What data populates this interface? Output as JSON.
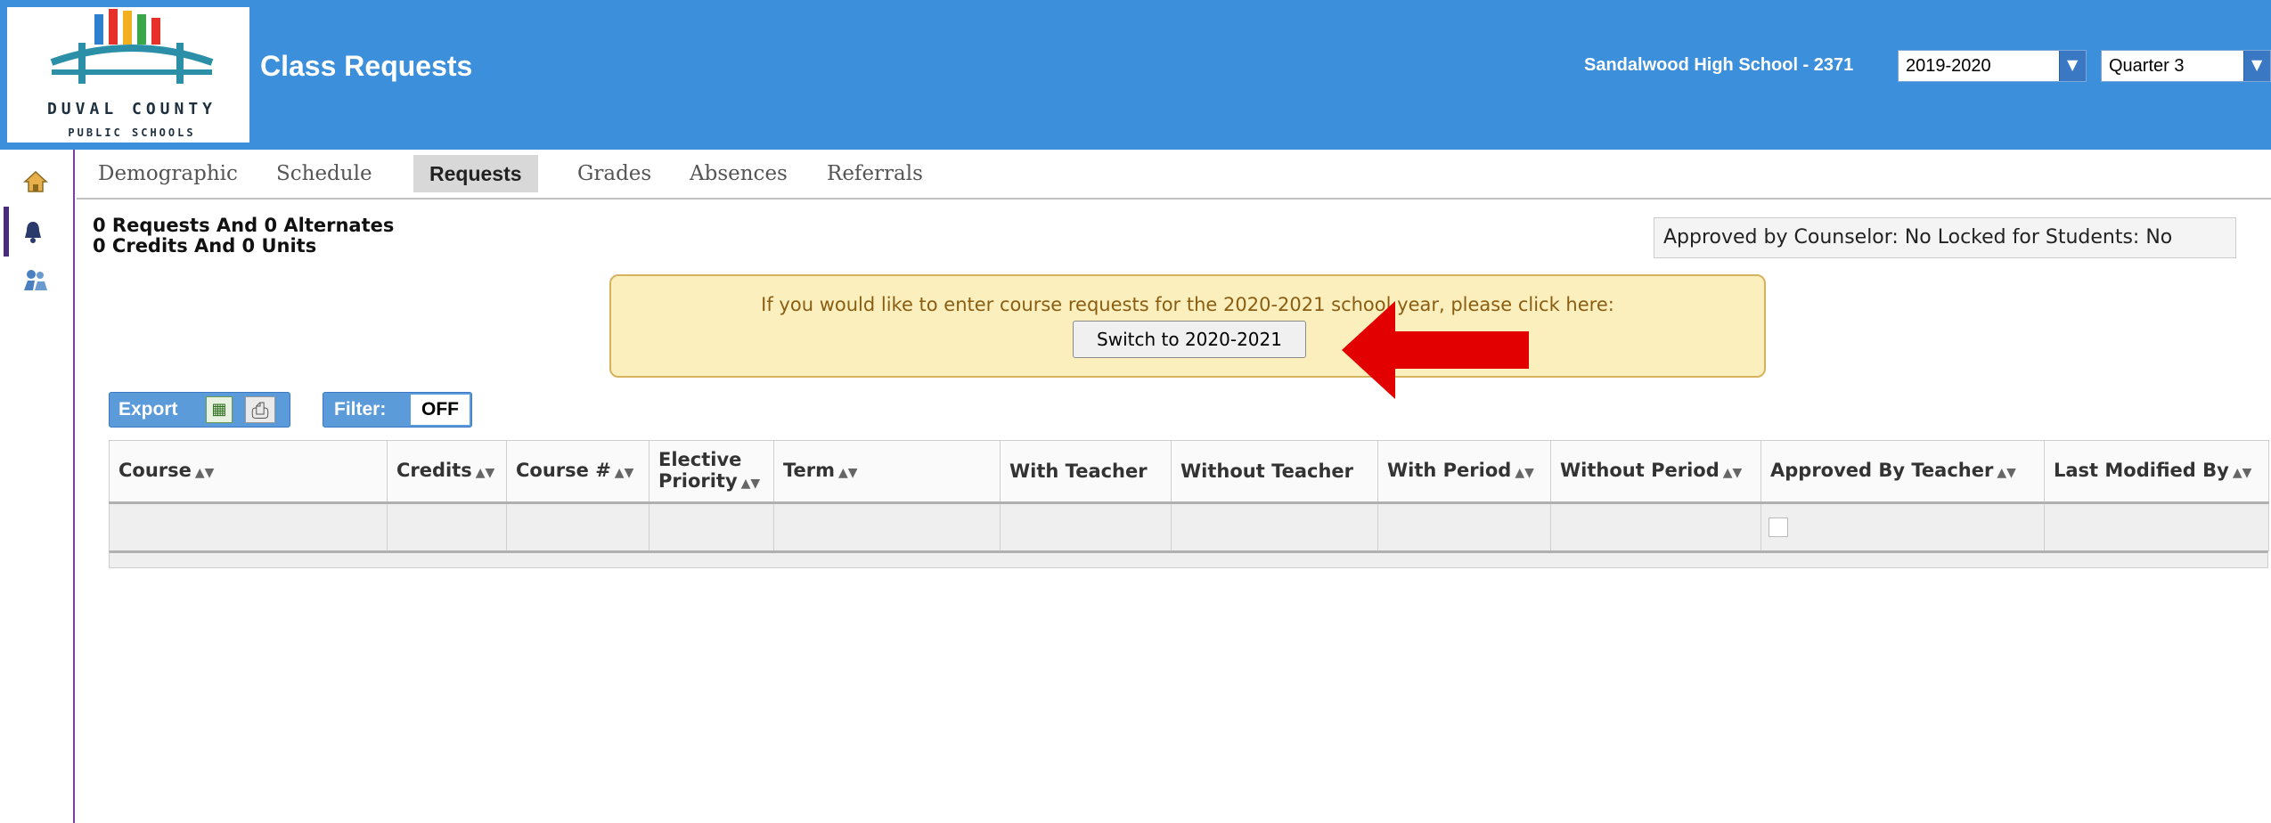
{
  "header": {
    "logo_line1": "DUVAL COUNTY",
    "logo_line2": "PUBLIC SCHOOLS",
    "title": "Class Requests",
    "school": "Sandalwood High School - 2371",
    "year_select": "2019-2020",
    "quarter_select": "Quarter 3"
  },
  "rail": [
    "home-icon",
    "bell-icon",
    "people-icon"
  ],
  "nav": {
    "tabs": [
      "Demographic",
      "Schedule",
      "Requests",
      "Grades",
      "Absences",
      "Referrals"
    ],
    "active": "Requests"
  },
  "summary": {
    "line1": "0 Requests And 0 Alternates",
    "line2": "0 Credits And 0 Units",
    "status": "Approved by Counselor: No  Locked for Students: No"
  },
  "notice": {
    "text": "If you would like to enter course requests for the 2020-2021 school year, please click here:",
    "button": "Switch to 2020-2021"
  },
  "toolbar": {
    "export_label": "Export",
    "filter_label": "Filter:",
    "filter_value": "OFF"
  },
  "table": {
    "columns": [
      {
        "label": "Course",
        "sortable": true
      },
      {
        "label": "Credits",
        "sortable": true
      },
      {
        "label": "Course #",
        "sortable": true
      },
      {
        "label": "Elective Priority",
        "sortable": true
      },
      {
        "label": "Term",
        "sortable": true
      },
      {
        "label": "With Teacher",
        "sortable": false
      },
      {
        "label": "Without Teacher",
        "sortable": false
      },
      {
        "label": "With Period",
        "sortable": true
      },
      {
        "label": "Without Period",
        "sortable": true
      },
      {
        "label": "Approved By Teacher",
        "sortable": true
      },
      {
        "label": "Last Modified By",
        "sortable": true
      }
    ]
  },
  "colors": {
    "header_bg": "#3c8fdb",
    "notice_bg": "#fbf0bd",
    "arrow": "#e30000"
  }
}
